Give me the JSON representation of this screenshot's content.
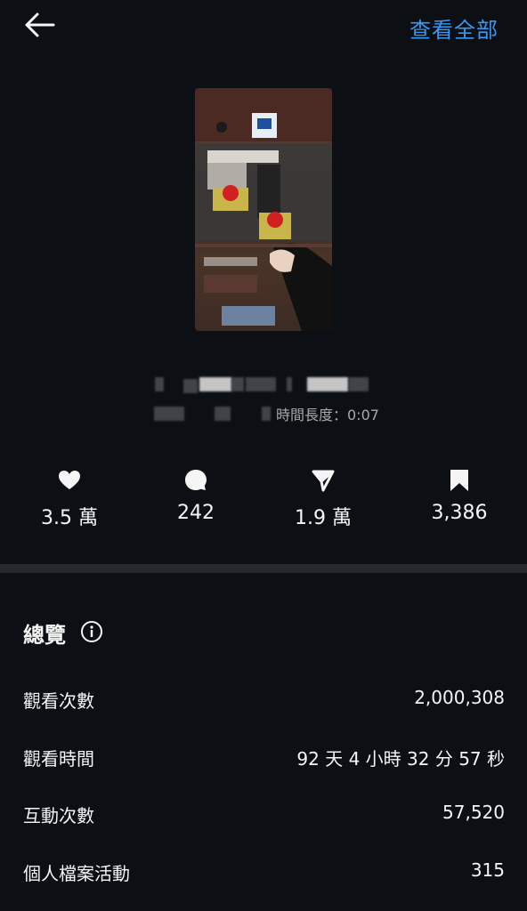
{
  "header": {
    "view_all_label": "查看全部"
  },
  "post": {
    "duration_text": "時間長度：0:07"
  },
  "stats": {
    "likes": "3.5 萬",
    "comments": "242",
    "shares": "1.9 萬",
    "saves": "3,386"
  },
  "overview": {
    "title": "總覽",
    "rows": [
      {
        "label": "觀看次數",
        "value": "2,000,308"
      },
      {
        "label": "觀看時間",
        "value": "92 天 4 小時 32 分 57 秒"
      },
      {
        "label": "互動次數",
        "value": "57,520"
      },
      {
        "label": "個人檔案活動",
        "value": "315"
      }
    ]
  },
  "icons": [
    "back-arrow-icon",
    "heart-icon",
    "comment-icon",
    "share-icon",
    "bookmark-icon",
    "info-icon"
  ],
  "colors": {
    "background": "#0c1014",
    "link": "#3897f0",
    "muted": "#a8a8a8",
    "divider": "#262a2e"
  }
}
